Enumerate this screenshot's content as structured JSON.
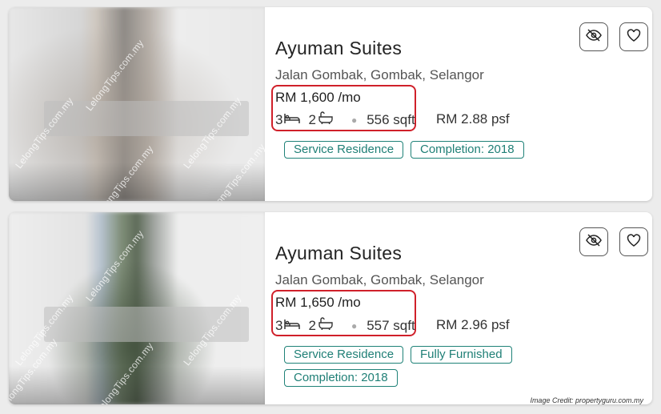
{
  "listings": [
    {
      "title": "Ayuman Suites",
      "address": "Jalan Gombak, Gombak, Selangor",
      "price": "RM 1,600 /mo",
      "bedrooms": "3",
      "bathrooms": "2",
      "area": "556 sqft",
      "psf": "RM 2.88 psf",
      "tags": [
        "Service Residence",
        "Completion: 2018"
      ]
    },
    {
      "title": "Ayuman Suites",
      "address": "Jalan Gombak, Gombak, Selangor",
      "price": "RM 1,650 /mo",
      "bedrooms": "3",
      "bathrooms": "2",
      "area": "557 sqft",
      "psf": "RM 2.96 psf",
      "tags": [
        "Service Residence",
        "Fully Furnished",
        "Completion: 2018"
      ]
    }
  ],
  "watermark": "LelongTips.com.my",
  "credit": "Image Credit: propertyguru.com.my",
  "icons": {
    "hide": "eye-slash-icon",
    "favorite": "heart-icon",
    "bed": "bed-icon",
    "bath": "bathtub-icon"
  },
  "colors": {
    "accent_teal": "#1f8278",
    "highlight_red": "#d0202a"
  }
}
